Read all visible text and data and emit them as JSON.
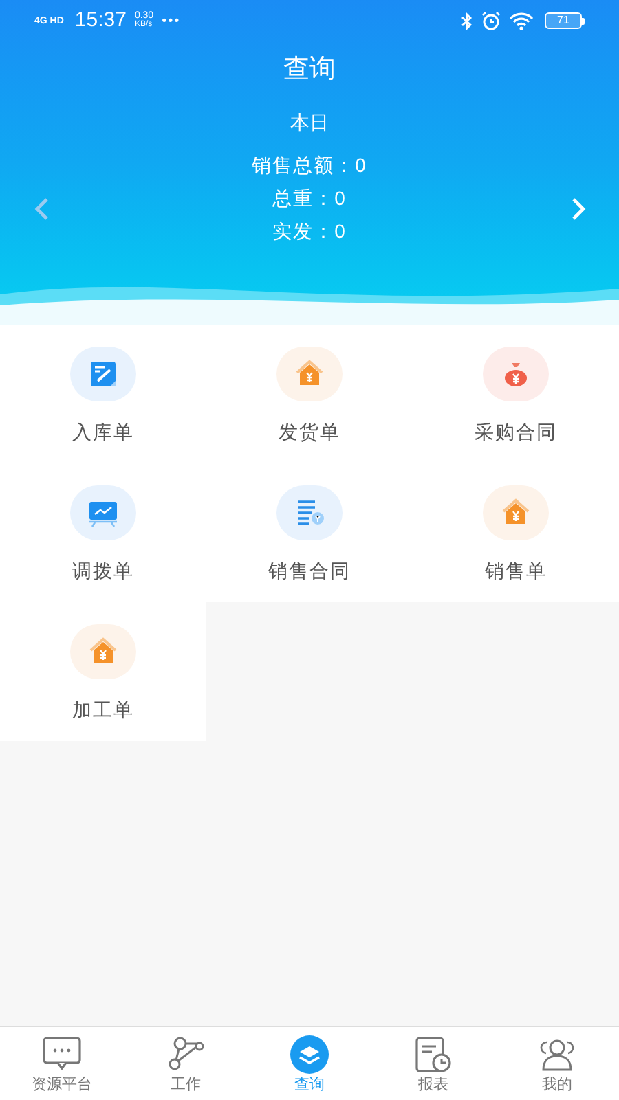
{
  "status_bar": {
    "network": "4G HD",
    "time": "15:37",
    "speed": "0.30",
    "speed_unit": "KB/s",
    "more": "•••",
    "battery": "71"
  },
  "header": {
    "title": "查询",
    "period": "本日",
    "stats": [
      "销售总额：0",
      "总重：0",
      "实发：0"
    ]
  },
  "grid": [
    {
      "label": "入库单",
      "kind": "edit"
    },
    {
      "label": "发货单",
      "kind": "house"
    },
    {
      "label": "采购合同",
      "kind": "bag"
    },
    {
      "label": "调拨单",
      "kind": "board"
    },
    {
      "label": "销售合同",
      "kind": "list"
    },
    {
      "label": "销售单",
      "kind": "house"
    },
    {
      "label": "加工单",
      "kind": "house"
    }
  ],
  "tabs": [
    {
      "label": "资源平台",
      "kind": "chat",
      "selected": false
    },
    {
      "label": "工作",
      "kind": "flow",
      "selected": false
    },
    {
      "label": "查询",
      "kind": "query",
      "selected": true
    },
    {
      "label": "报表",
      "kind": "report",
      "selected": false
    },
    {
      "label": "我的",
      "kind": "user",
      "selected": false
    }
  ]
}
